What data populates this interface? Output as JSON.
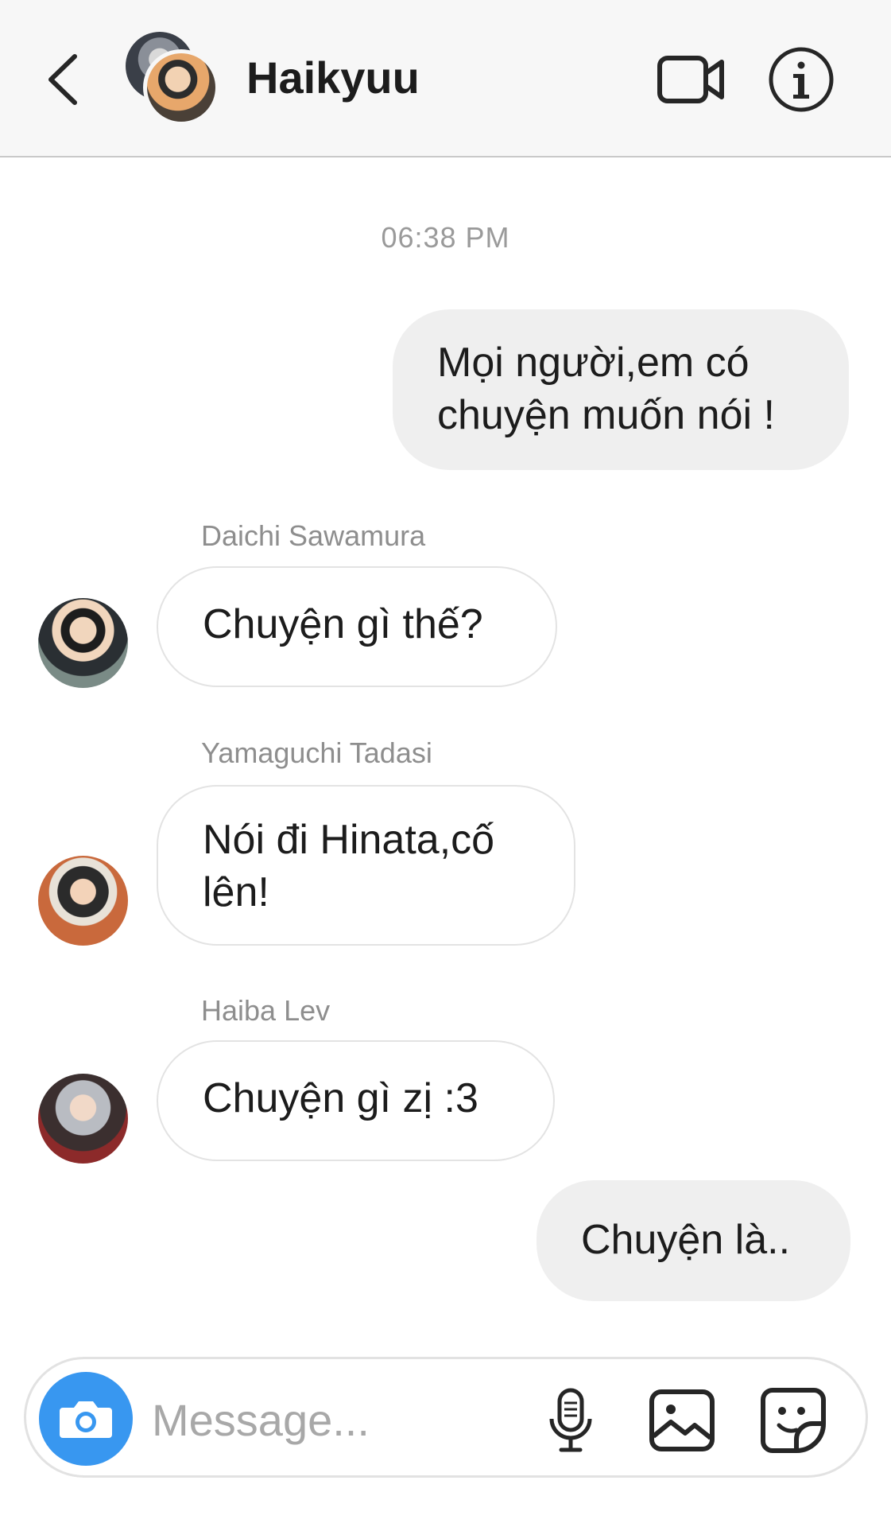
{
  "header": {
    "title": "Haikyuu"
  },
  "timestamp": "06:38 PM",
  "messages": [
    {
      "direction": "outgoing",
      "lines": [
        "Mọi người,em có",
        "chuyện muốn nói !"
      ]
    },
    {
      "direction": "incoming",
      "sender": "Daichi Sawamura",
      "text": "Chuyện gì thế?"
    },
    {
      "direction": "incoming",
      "sender": "Yamaguchi Tadasi",
      "lines": [
        "Nói đi Hinata,cố",
        "lên!"
      ]
    },
    {
      "direction": "incoming",
      "sender": "Haiba Lev",
      "text": "Chuyện gì zị :3"
    },
    {
      "direction": "outgoing",
      "text": "Chuyện là.."
    }
  ],
  "composer": {
    "placeholder": "Message..."
  },
  "colors": {
    "accent": "#3897f0",
    "outgoing_bubble": "#efefef",
    "header_bg": "#f7f7f7"
  },
  "icons": {
    "back": "chevron-left-icon",
    "video": "video-camera-icon",
    "info": "info-icon",
    "camera": "camera-icon",
    "mic": "microphone-icon",
    "gallery": "image-icon",
    "sticker": "sticker-icon"
  }
}
